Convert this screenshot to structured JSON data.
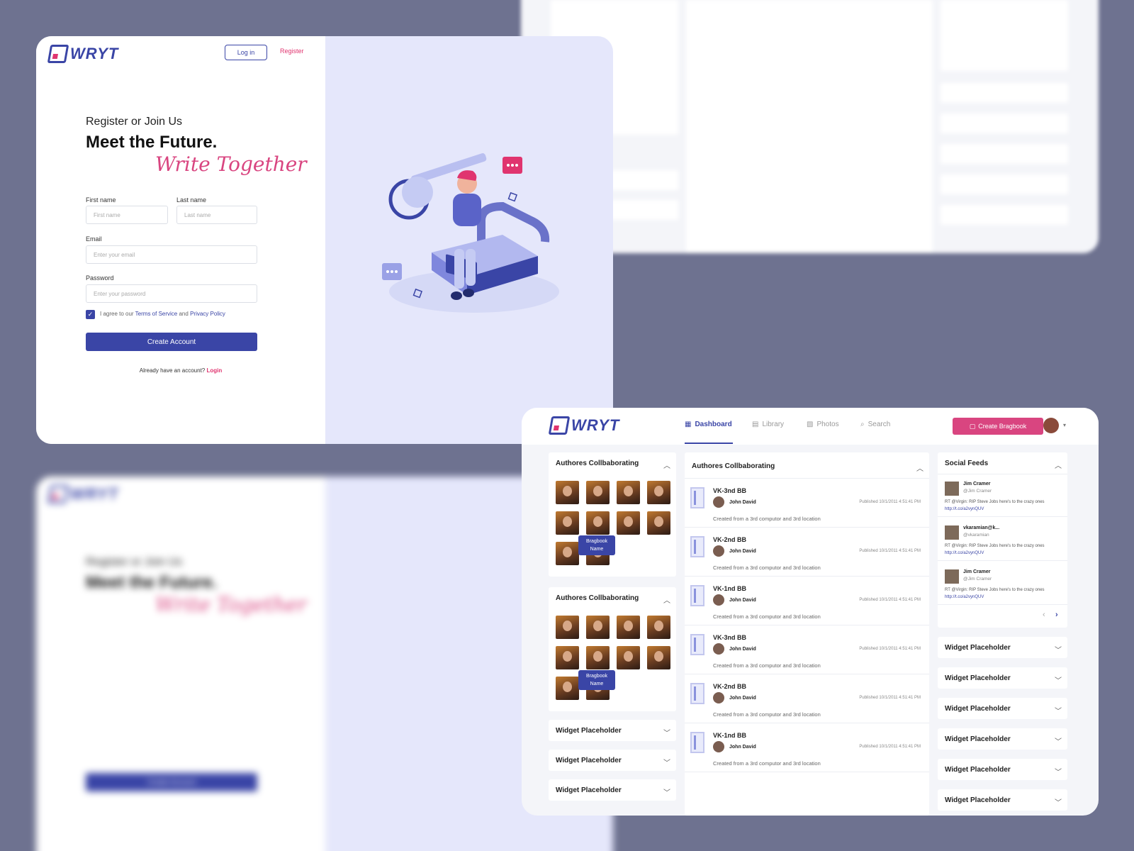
{
  "brand": {
    "name": "WRYT"
  },
  "register": {
    "login_button": "Log in",
    "register_link": "Register",
    "subtitle": "Register or Join Us",
    "headline": "Meet the Future.",
    "script_tagline": "Write Together",
    "first_name_label": "First name",
    "first_name_placeholder": "First name",
    "last_name_label": "Last name",
    "last_name_placeholder": "Last name",
    "email_label": "Email",
    "email_placeholder": "Enter your email",
    "password_label": "Password",
    "password_placeholder": "Enter your password",
    "agree_prefix": "I agree to our",
    "terms": "Terms of Service",
    "and": "and",
    "privacy": "Privacy Policy",
    "agree_checked": true,
    "create_button": "Create Account",
    "already_text": "Already have an account?",
    "login_link": "Login"
  },
  "dashboard": {
    "nav": [
      {
        "label": "Dashboard",
        "icon": "grid-icon",
        "active": true
      },
      {
        "label": "Library",
        "icon": "library-icon",
        "active": false
      },
      {
        "label": "Photos",
        "icon": "image-icon",
        "active": false
      },
      {
        "label": "Search",
        "icon": "search-icon",
        "active": false
      }
    ],
    "create_button": "Create Bragbook",
    "left_panels": [
      {
        "title": "Authores Collbaborating",
        "tooltip_line1": "Bragbook",
        "tooltip_line2": "Name"
      },
      {
        "title": "Authores Collbaborating",
        "tooltip_line1": "Bragbook",
        "tooltip_line2": "Name"
      }
    ],
    "left_widgets": [
      "Widget Placeholder",
      "Widget Placeholder",
      "Widget Placeholder"
    ],
    "center_title": "Authores Collbaborating",
    "rows": [
      {
        "title": "VK-3nd BB",
        "author": "John David",
        "published": "Published 10/1/2011 4:51:41 PM",
        "desc": "Created from a 3rd computor and 3rd location"
      },
      {
        "title": "VK-2nd BB",
        "author": "John David",
        "published": "Published 10/1/2011 4:51:41 PM",
        "desc": "Created from a 3rd computor and 3rd location"
      },
      {
        "title": "VK-1nd BB",
        "author": "John David",
        "published": "Published 10/1/2011 4:51:41 PM",
        "desc": "Created from a 3rd computor and 3rd location"
      },
      {
        "title": "VK-3nd BB",
        "author": "John David",
        "published": "Published 10/1/2011 4:51:41 PM",
        "desc": "Created from a 3rd computor and 3rd location"
      },
      {
        "title": "VK-2nd BB",
        "author": "John David",
        "published": "Published 10/1/2011 4:51:41 PM",
        "desc": "Created from a 3rd computor and 3rd location"
      },
      {
        "title": "VK-1nd BB",
        "author": "John David",
        "published": "Published 10/1/2011 4:51:41 PM",
        "desc": "Created from a 3rd computor and 3rd location"
      }
    ],
    "social_title": "Social Feeds",
    "feeds": [
      {
        "name": "Jim Cramer",
        "handle": "@Jim Cramer",
        "text": "RT @Virgin: RIP Steve Jobs here's to the crazy ones",
        "link": "http://t.co/a2vynQUV"
      },
      {
        "name": "vkaramian@k...",
        "handle": "@vkaramian",
        "text": "RT @Virgin: RIP Steve Jobs here's to the crazy ones",
        "link": "http://t.co/a2vynQUV"
      },
      {
        "name": "Jim Cramer",
        "handle": "@Jim Cramer",
        "text": "RT @Virgin: RIP Steve Jobs here's to the crazy ones",
        "link": "http://t.co/a2vynQUV"
      }
    ],
    "right_widgets": [
      "Widget Placeholder",
      "Widget Placeholder",
      "Widget Placeholder",
      "Widget Placeholder",
      "Widget Placeholder",
      "Widget Placeholder"
    ]
  },
  "colors": {
    "primary": "#3a45a6",
    "accent": "#d94580",
    "illustration_bg": "#e5e7fb",
    "backdrop": "#6e7290"
  }
}
